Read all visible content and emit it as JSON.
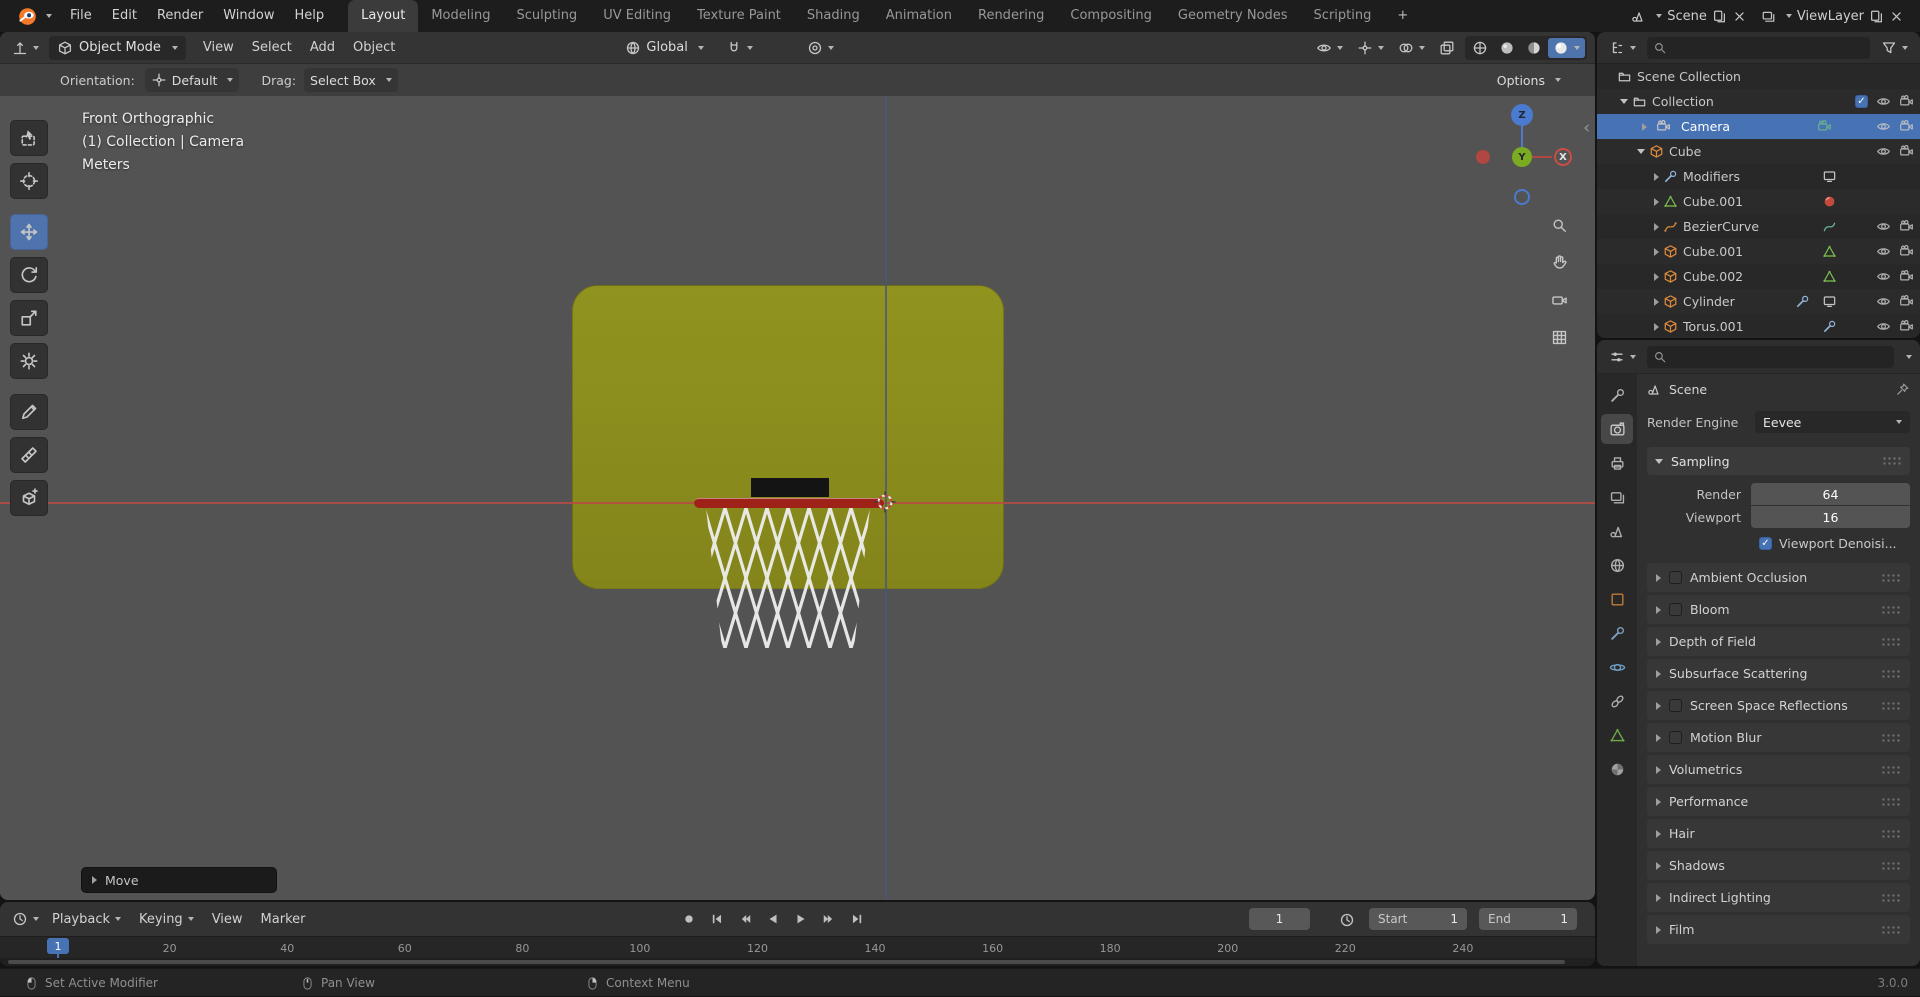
{
  "colors": {
    "accent": "#4772b3",
    "object_orange": "#dd8a3d",
    "mesh_green": "#7cc24e",
    "backboard_olive": "#8b8d1e",
    "rim_red": "#9e2218",
    "axis_red": "#b94a44",
    "axis_blue": "#4a587a"
  },
  "topbar": {
    "menus": [
      "File",
      "Edit",
      "Render",
      "Window",
      "Help"
    ],
    "tabs": [
      "Layout",
      "Modeling",
      "Sculpting",
      "UV Editing",
      "Texture Paint",
      "Shading",
      "Animation",
      "Rendering",
      "Compositing",
      "Geometry Nodes",
      "Scripting"
    ],
    "active_tab": "Layout",
    "add_tab": "+",
    "scene": {
      "label": "Scene"
    },
    "view_layer": {
      "label": "ViewLayer"
    }
  },
  "viewport_header": {
    "mode": "Object Mode",
    "menus": [
      "View",
      "Select",
      "Add",
      "Object"
    ],
    "orientation": "Global"
  },
  "tool_settings": {
    "orientation_label": "Orientation:",
    "orientation_value": "Default",
    "drag_label": "Drag:",
    "drag_value": "Select Box",
    "options_label": "Options"
  },
  "viewport": {
    "overlay": {
      "line1": "Front Orthographic",
      "line2": "(1) Collection | Camera",
      "line3": "Meters"
    },
    "operator_panel": "Move",
    "gizmo": {
      "z": "Z",
      "y": "Y",
      "x": "X"
    },
    "tools": [
      "select-box",
      "cursor",
      "move",
      "rotate",
      "scale",
      "transform",
      "annotate",
      "measure",
      "add-cube"
    ],
    "active_tool": "move"
  },
  "outliner": {
    "rows": [
      {
        "label": "Scene Collection",
        "indent": 0,
        "arrow": null,
        "icon": "collection",
        "toggles": false
      },
      {
        "label": "Collection",
        "indent": 1,
        "arrow": "down",
        "icon": "collection",
        "checkbox": true,
        "toggles": true
      },
      {
        "label": "Camera",
        "indent": 2,
        "arrow": "right",
        "icon": "cam-obj",
        "selected": true,
        "extra": [
          "cam-data"
        ],
        "toggles": true
      },
      {
        "label": "Cube",
        "indent": 2,
        "arrow": "down",
        "icon": "cube",
        "toggles": true
      },
      {
        "label": "Modifiers",
        "indent": 3,
        "arrow": "right",
        "icon": "wrench-blue",
        "extra": [
          "screen"
        ],
        "toggles": false
      },
      {
        "label": "Cube.001",
        "indent": 3,
        "arrow": "right",
        "icon": "mesh-green",
        "extra": [
          "material-ball"
        ],
        "toggles": false
      },
      {
        "label": "BezierCurve",
        "indent": 3,
        "arrow": "right",
        "icon": "curve-obj",
        "extra": [
          "curve-data"
        ],
        "toggles": true
      },
      {
        "label": "Cube.001",
        "indent": 3,
        "arrow": "right",
        "icon": "cube",
        "extra": [
          "mesh-green"
        ],
        "toggles": true
      },
      {
        "label": "Cube.002",
        "indent": 3,
        "arrow": "right",
        "icon": "cube",
        "extra": [
          "mesh-green"
        ],
        "toggles": true
      },
      {
        "label": "Cylinder",
        "indent": 3,
        "arrow": "right",
        "icon": "cube",
        "extra": [
          "wrench-blue",
          "screen"
        ],
        "toggles": true
      },
      {
        "label": "Torus.001",
        "indent": 3,
        "arrow": "right",
        "icon": "cube",
        "extra": [
          "wrench-blue"
        ],
        "toggles": true
      }
    ]
  },
  "properties": {
    "tabs": [
      "tool",
      "render",
      "output",
      "view-layer",
      "scene",
      "world",
      "object",
      "modifiers",
      "physics",
      "constraints",
      "data",
      "material"
    ],
    "active_tab": "render",
    "breadcrumb": "Scene",
    "render_engine_label": "Render Engine",
    "render_engine_value": "Eevee",
    "sampling": {
      "title": "Sampling",
      "rows": [
        {
          "label": "Render",
          "value": "64"
        },
        {
          "label": "Viewport",
          "value": "16"
        }
      ],
      "denoise_label": "Viewport Denoisi...",
      "denoise_checked": true
    },
    "sections": [
      {
        "label": "Ambient Occlusion",
        "checkbox": true
      },
      {
        "label": "Bloom",
        "checkbox": true
      },
      {
        "label": "Depth of Field",
        "checkbox": false
      },
      {
        "label": "Subsurface Scattering",
        "checkbox": false
      },
      {
        "label": "Screen Space Reflections",
        "checkbox": true
      },
      {
        "label": "Motion Blur",
        "checkbox": true
      },
      {
        "label": "Volumetrics",
        "checkbox": false
      },
      {
        "label": "Performance",
        "checkbox": false
      },
      {
        "label": "Hair",
        "checkbox": false
      },
      {
        "label": "Shadows",
        "checkbox": false
      },
      {
        "label": "Indirect Lighting",
        "checkbox": false
      },
      {
        "label": "Film",
        "checkbox": false
      }
    ]
  },
  "timeline": {
    "menus": [
      "Playback",
      "Keying",
      "View",
      "Marker"
    ],
    "current_frame": "1",
    "start_label": "Start",
    "start_value": "1",
    "end_label": "End",
    "end_value": "1",
    "ticks": [
      20,
      40,
      60,
      80,
      100,
      120,
      140,
      160,
      180,
      200,
      220,
      240
    ]
  },
  "statusbar": {
    "hints": [
      {
        "icon": "mouse-left",
        "label": "Set Active Modifier"
      },
      {
        "icon": "mouse-mid",
        "label": "Pan View"
      },
      {
        "icon": "mouse-right",
        "label": "Context Menu"
      }
    ],
    "version": "3.0.0"
  }
}
